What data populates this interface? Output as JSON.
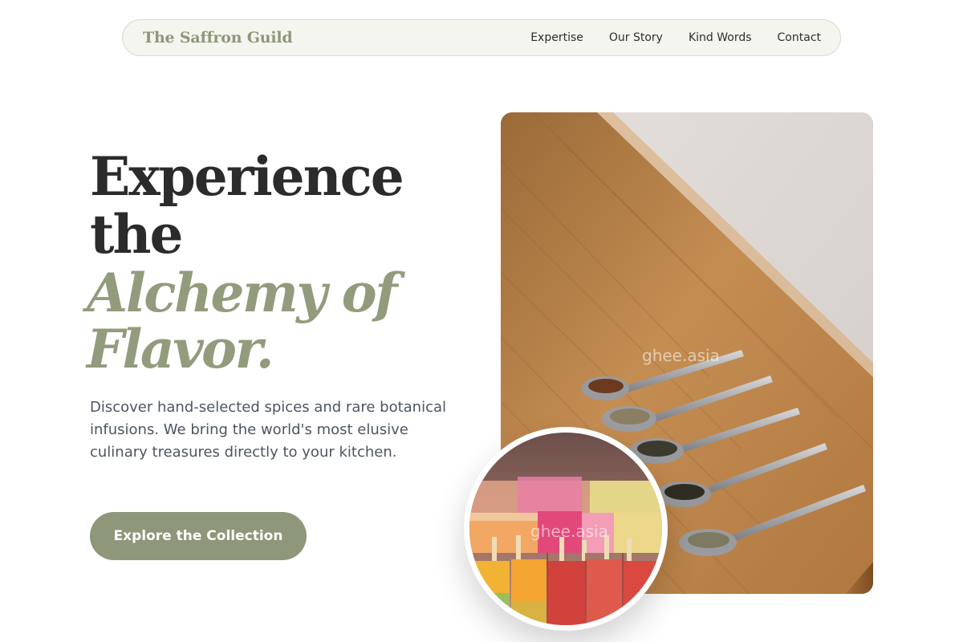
{
  "nav": {
    "brand": "The Saffron Guild",
    "links": [
      "Expertise",
      "Our Story",
      "Kind Words",
      "Contact"
    ]
  },
  "hero": {
    "title_line1": "Experience",
    "title_line2": "the",
    "accent_line1": "Alchemy of",
    "accent_line2": "Flavor.",
    "description": "Discover hand-selected spices and rare botanical infusions. We bring the world's most elusive culinary treasures directly to your kitchen.",
    "cta_label": "Explore the Collection"
  },
  "images": {
    "main_watermark": "ghee.asia",
    "circle_watermark": "ghee.asia"
  },
  "colors": {
    "accent": "#8e977a",
    "heading": "#2b2b2b",
    "body_text": "#4d5560",
    "nav_bg": "#f4f5ef"
  }
}
